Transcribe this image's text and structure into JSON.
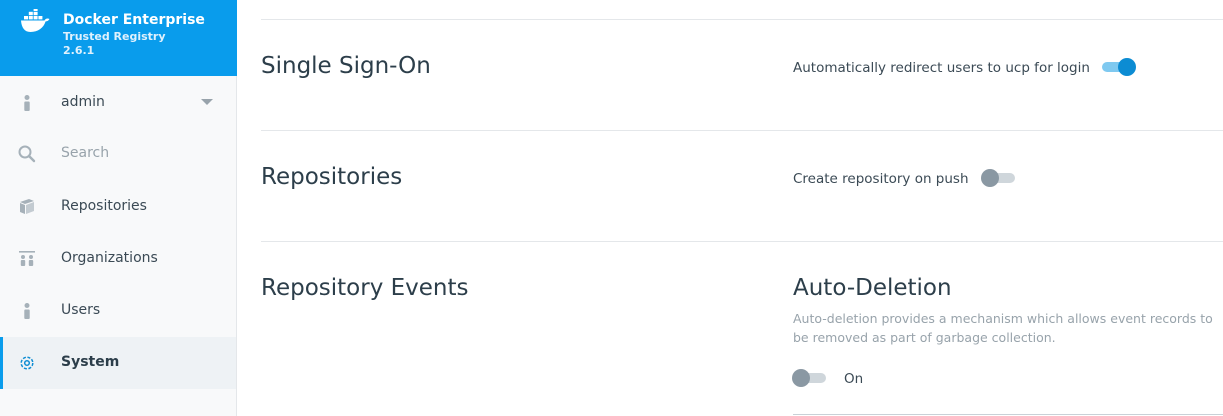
{
  "brand": {
    "title": "Docker Enterprise",
    "subtitle": "Trusted Registry",
    "version": "2.6.1",
    "color": "#099cec"
  },
  "sidebar": {
    "user": {
      "label": "admin",
      "icon": "user-icon"
    },
    "search": {
      "label": "Search",
      "icon": "search-icon"
    },
    "items": [
      {
        "label": "Repositories",
        "icon": "repositories-icon"
      },
      {
        "label": "Organizations",
        "icon": "organizations-icon"
      },
      {
        "label": "Users",
        "icon": "user-icon"
      },
      {
        "label": "System",
        "icon": "gear-icon",
        "active": true
      }
    ]
  },
  "sections": {
    "sso": {
      "title": "Single Sign-On",
      "option_label": "Automatically redirect users to ucp for login",
      "enabled": true
    },
    "repositories": {
      "title": "Repositories",
      "option_label": "Create repository on push",
      "enabled": false
    },
    "events": {
      "title": "Repository Events",
      "auto_deletion": {
        "title": "Auto-Deletion",
        "description": "Auto-deletion provides a mechanism which allows event records to be removed as part of garbage collection.",
        "toggle_label": "On",
        "enabled": false
      }
    }
  },
  "colors": {
    "accent": "#099cec",
    "toggle_on": "#0c8cd3"
  }
}
